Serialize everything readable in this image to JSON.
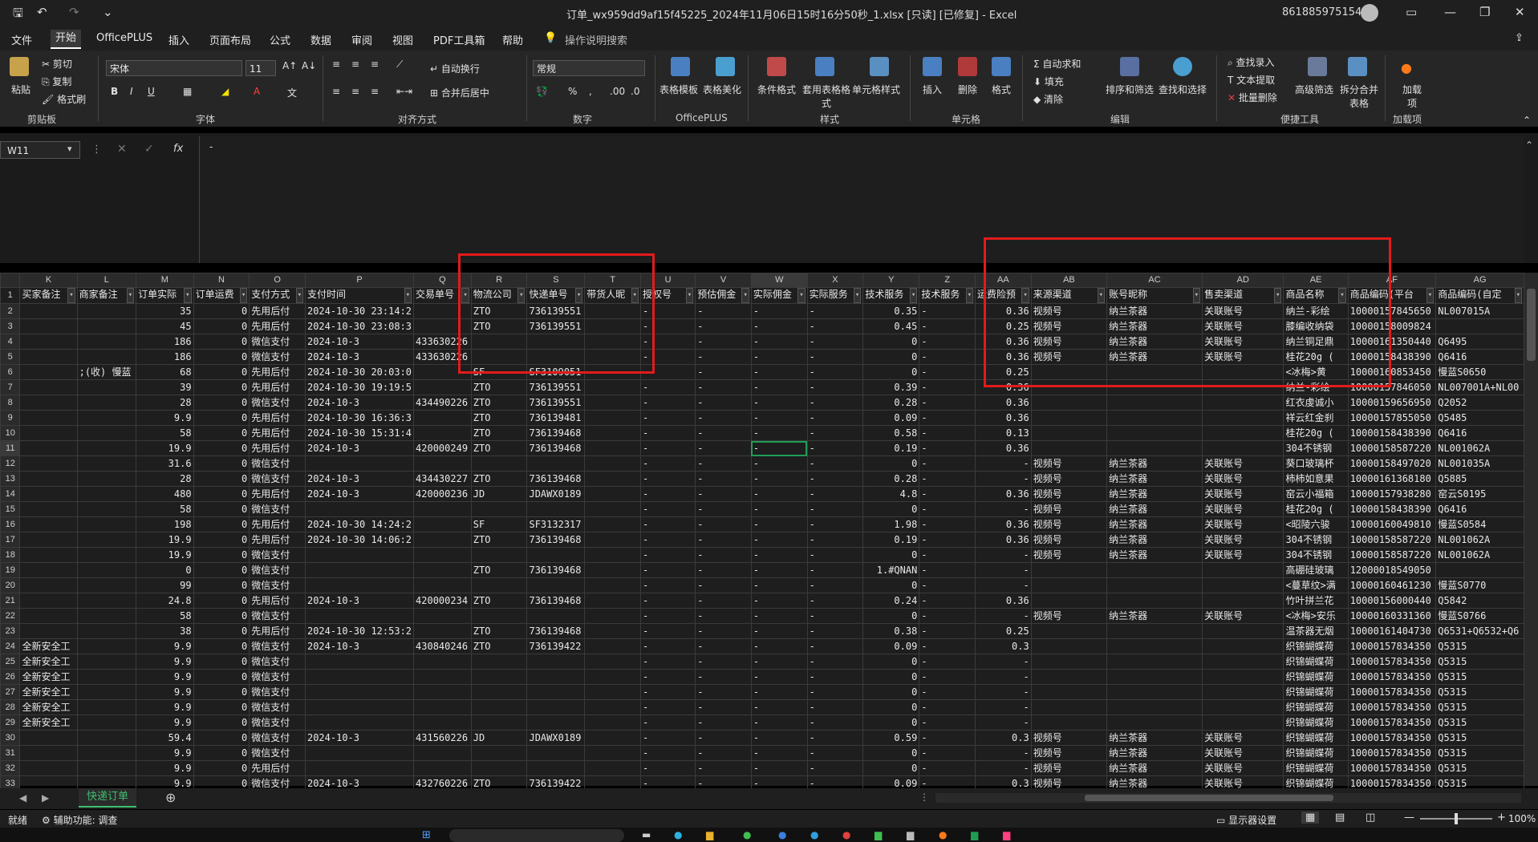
{
  "titlebar": {
    "title": "订单_wx959dd9af15f45225_2024年11月06日15时16分50秒_1.xlsx  [只读] [已修复]  -  Excel",
    "user": "8618859751545"
  },
  "menu": [
    "文件",
    "开始",
    "OfficePLUS",
    "插入",
    "页面布局",
    "公式",
    "数据",
    "审阅",
    "视图",
    "PDF工具箱",
    "帮助"
  ],
  "search_placeholder": "操作说明搜索",
  "ribbon": {
    "clipboard": {
      "paste": "粘贴",
      "cut": "剪切",
      "copy": "复制",
      "format_painter": "格式刷",
      "group": "剪贴板"
    },
    "font": {
      "name": "宋体",
      "size": "11",
      "group": "字体"
    },
    "alignment": {
      "wrap": "自动换行",
      "merge": "合并后居中",
      "group": "对齐方式"
    },
    "number": {
      "format": "常规",
      "group": "数字"
    },
    "officeplus": {
      "table_template": "表格模板",
      "table_beautify": "表格美化",
      "group": "OfficePLUS"
    },
    "styles": {
      "conditional": "条件格式",
      "apply": "套用表格格式",
      "cell_styles": "单元格样式",
      "group": "样式"
    },
    "cells": {
      "insert": "插入",
      "delete": "删除",
      "format": "格式",
      "group": "单元格"
    },
    "editing": {
      "autosum": "自动求和",
      "fill": "填充",
      "clear": "清除",
      "sort": "排序和筛选",
      "find": "查找和选择",
      "group": "编辑"
    },
    "tools": {
      "find_input": "查找录入",
      "text_extract": "文本提取",
      "batch_delete": "批量删除",
      "adv_filter": "高级筛选",
      "split_merge": "拆分合并表格",
      "group": "便捷工具"
    },
    "addins": {
      "label": "加载项",
      "group": "加载项"
    }
  },
  "formula": {
    "namebox": "W11",
    "value": "-"
  },
  "columns": [
    "K",
    "L",
    "M",
    "N",
    "O",
    "P",
    "Q",
    "R",
    "S",
    "T",
    "U",
    "V",
    "W",
    "X",
    "Y",
    "Z",
    "AA",
    "AB",
    "AC",
    "AD",
    "AE",
    "AF",
    "AG"
  ],
  "header_row": [
    "买家备注",
    "商家备注",
    "订单实际",
    "订单运费",
    "支付方式",
    "支付时间",
    "交易单号",
    "物流公司",
    "快递单号",
    "带货人昵",
    "授权号",
    "预估佣金",
    "实际佣金",
    "实际服务",
    "技术服务",
    "技术服务",
    "运费险预",
    "来源渠道",
    "账号昵称",
    "售卖渠道",
    "商品名称",
    "商品编码(平台",
    "商品编码(自定"
  ],
  "rows": [
    [
      "",
      "",
      "35",
      "0",
      "先用后付",
      "2024-10-30  23:14:2",
      "",
      "ZTO",
      "736139551",
      "",
      "-",
      "-",
      "-",
      "-",
      "0.35",
      "-",
      "0.36",
      "视频号",
      "纳兰茶器",
      "关联账号",
      "纳兰-彩绘",
      "10000157845650",
      "NL007015A"
    ],
    [
      "",
      "",
      "45",
      "0",
      "先用后付",
      "2024-10-30  23:08:3",
      "",
      "ZTO",
      "736139551",
      "",
      "-",
      "-",
      "-",
      "-",
      "0.45",
      "-",
      "0.25",
      "视频号",
      "纳兰茶器",
      "关联账号",
      "膝编收纳袋",
      "10000158009824",
      ""
    ],
    [
      "",
      "",
      "186",
      "0",
      "微信支付",
      "2024-10-3",
      "433630226",
      "",
      "",
      "",
      "-",
      "-",
      "-",
      "-",
      "0",
      "-",
      "0.36",
      "视频号",
      "纳兰茶器",
      "关联账号",
      "纳兰铜足鼎",
      "10000161350440",
      "Q6495"
    ],
    [
      "",
      "",
      "186",
      "0",
      "微信支付",
      "2024-10-3",
      "433630226",
      "",
      "",
      "",
      "-",
      "-",
      "-",
      "-",
      "0",
      "-",
      "0.36",
      "视频号",
      "纳兰茶器",
      "关联账号",
      "桂花20g (",
      "10000158438390",
      "Q6416"
    ],
    [
      "",
      ";(收) 慢蓝",
      "68",
      "0",
      "先用后付",
      "2024-10-30  20:03:0",
      "",
      "SF",
      "SF3109051",
      "",
      "-",
      "-",
      "-",
      "-",
      "0",
      "-",
      "0.25",
      "",
      "",
      "",
      "<冰梅>黄",
      "10000160853450",
      "慢蓝S0650"
    ],
    [
      "",
      "",
      "39",
      "0",
      "先用后付",
      "2024-10-30  19:19:5",
      "",
      "ZTO",
      "736139551",
      "",
      "-",
      "-",
      "-",
      "-",
      "0.39",
      "-",
      "0.36",
      "",
      "",
      "",
      "纳兰-彩绘",
      "10000157846050",
      "NL007001A+NL00"
    ],
    [
      "",
      "",
      "28",
      "0",
      "微信支付",
      "2024-10-3",
      "434490226",
      "ZTO",
      "736139551",
      "",
      "-",
      "-",
      "-",
      "-",
      "0.28",
      "-",
      "0.36",
      "",
      "",
      "",
      "红衣虔诚小",
      "10000159656950",
      "Q2052"
    ],
    [
      "",
      "",
      "9.9",
      "0",
      "先用后付",
      "2024-10-30  16:36:3",
      "",
      "ZTO",
      "736139481",
      "",
      "-",
      "-",
      "-",
      "-",
      "0.09",
      "-",
      "0.36",
      "",
      "",
      "",
      "祥云红金刹",
      "10000157855050",
      "Q5485"
    ],
    [
      "",
      "",
      "58",
      "0",
      "先用后付",
      "2024-10-30  15:31:4",
      "",
      "ZTO",
      "736139468",
      "",
      "-",
      "-",
      "-",
      "-",
      "0.58",
      "-",
      "0.13",
      "",
      "",
      "",
      "桂花20g (",
      "10000158438390",
      "Q6416"
    ],
    [
      "",
      "",
      "19.9",
      "0",
      "先用后付",
      "2024-10-3",
      "420000249",
      "ZTO",
      "736139468",
      "",
      "-",
      "-",
      "-",
      "-",
      "0.19",
      "-",
      "0.36",
      "",
      "",
      "",
      "304不锈钢",
      "10000158587220",
      "NL001062A"
    ],
    [
      "",
      "",
      "31.6",
      "0",
      "微信支付",
      "",
      "",
      "",
      "",
      "",
      "-",
      "-",
      "-",
      "-",
      "0",
      "-",
      "-",
      "视频号",
      "纳兰茶器",
      "关联账号",
      "葵口玻璃杯",
      "10000158497020",
      "NL001035A"
    ],
    [
      "",
      "",
      "28",
      "0",
      "微信支付",
      "2024-10-3",
      "434430227",
      "ZTO",
      "736139468",
      "",
      "-",
      "-",
      "-",
      "-",
      "0.28",
      "-",
      "-",
      "视频号",
      "纳兰茶器",
      "关联账号",
      "柿柿如意果",
      "10000161368180",
      "Q5885"
    ],
    [
      "",
      "",
      "480",
      "0",
      "先用后付",
      "2024-10-3",
      "420000236",
      "JD",
      "JDAWX0189",
      "",
      "-",
      "-",
      "-",
      "-",
      "4.8",
      "-",
      "0.36",
      "视频号",
      "纳兰茶器",
      "关联账号",
      "窑云小福箱",
      "10000157938280",
      "窑云S0195"
    ],
    [
      "",
      "",
      "58",
      "0",
      "微信支付",
      "",
      "",
      "",
      "",
      "",
      "-",
      "-",
      "-",
      "-",
      "0",
      "-",
      "-",
      "视频号",
      "纳兰茶器",
      "关联账号",
      "桂花20g (",
      "10000158438390",
      "Q6416"
    ],
    [
      "",
      "",
      "198",
      "0",
      "先用后付",
      "2024-10-30  14:24:2",
      "",
      "SF",
      "SF3132317",
      "",
      "-",
      "-",
      "-",
      "-",
      "1.98",
      "-",
      "0.36",
      "视频号",
      "纳兰茶器",
      "关联账号",
      "<昭陵六骏",
      "10000160049810",
      "慢蓝S0584"
    ],
    [
      "",
      "",
      "19.9",
      "0",
      "先用后付",
      "2024-10-30  14:06:2",
      "",
      "ZTO",
      "736139468",
      "",
      "-",
      "-",
      "-",
      "-",
      "0.19",
      "-",
      "0.36",
      "视频号",
      "纳兰茶器",
      "关联账号",
      "304不锈钢",
      "10000158587220",
      "NL001062A"
    ],
    [
      "",
      "",
      "19.9",
      "0",
      "微信支付",
      "",
      "",
      "",
      "",
      "",
      "-",
      "-",
      "-",
      "-",
      "0",
      "-",
      "-",
      "视频号",
      "纳兰茶器",
      "关联账号",
      "304不锈钢",
      "10000158587220",
      "NL001062A"
    ],
    [
      "",
      "",
      "0",
      "0",
      "微信支付",
      "",
      "",
      "ZTO",
      "736139468",
      "",
      "-",
      "-",
      "-",
      "-",
      "1.#QNAN",
      "-",
      "-",
      "",
      "",
      "",
      "高硼硅玻璃",
      "12000018549050",
      ""
    ],
    [
      "",
      "",
      "99",
      "0",
      "微信支付",
      "",
      "",
      "",
      "",
      "",
      "-",
      "-",
      "-",
      "-",
      "0",
      "-",
      "-",
      "",
      "",
      "",
      "<蔓草纹>满",
      "10000160461230",
      "慢蓝S0770"
    ],
    [
      "",
      "",
      "24.8",
      "0",
      "先用后付",
      "2024-10-3",
      "420000234",
      "ZTO",
      "736139468",
      "",
      "-",
      "-",
      "-",
      "-",
      "0.24",
      "-",
      "0.36",
      "",
      "",
      "",
      "竹叶拼兰花",
      "10000156000440",
      "Q5842"
    ],
    [
      "",
      "",
      "58",
      "0",
      "微信支付",
      "",
      "",
      "",
      "",
      "",
      "-",
      "-",
      "-",
      "-",
      "0",
      "-",
      "-",
      "视频号",
      "纳兰茶器",
      "关联账号",
      "<冰梅>安乐",
      "10000160331360",
      "慢蓝S0766"
    ],
    [
      "",
      "",
      "38",
      "0",
      "先用后付",
      "2024-10-30  12:53:2",
      "",
      "ZTO",
      "736139468",
      "",
      "-",
      "-",
      "-",
      "-",
      "0.38",
      "-",
      "0.25",
      "",
      "",
      "",
      "温茶器无烟",
      "10000161404730",
      "Q6531+Q6532+Q6"
    ],
    [
      "全新安全工",
      "",
      "9.9",
      "0",
      "微信支付",
      "2024-10-3",
      "430840246",
      "ZTO",
      "736139422",
      "",
      "-",
      "-",
      "-",
      "-",
      "0.09",
      "-",
      "0.3",
      "",
      "",
      "",
      "织锦蝴蝶荷",
      "10000157834350",
      "Q5315"
    ],
    [
      "全新安全工",
      "",
      "9.9",
      "0",
      "微信支付",
      "",
      "",
      "",
      "",
      "",
      "-",
      "-",
      "-",
      "-",
      "0",
      "-",
      "-",
      "",
      "",
      "",
      "织锦蝴蝶荷",
      "10000157834350",
      "Q5315"
    ],
    [
      "全新安全工",
      "",
      "9.9",
      "0",
      "微信支付",
      "",
      "",
      "",
      "",
      "",
      "-",
      "-",
      "-",
      "-",
      "0",
      "-",
      "-",
      "",
      "",
      "",
      "织锦蝴蝶荷",
      "10000157834350",
      "Q5315"
    ],
    [
      "全新安全工",
      "",
      "9.9",
      "0",
      "微信支付",
      "",
      "",
      "",
      "",
      "",
      "-",
      "-",
      "-",
      "-",
      "0",
      "-",
      "-",
      "",
      "",
      "",
      "织锦蝴蝶荷",
      "10000157834350",
      "Q5315"
    ],
    [
      "全新安全工",
      "",
      "9.9",
      "0",
      "微信支付",
      "",
      "",
      "",
      "",
      "",
      "-",
      "-",
      "-",
      "-",
      "0",
      "-",
      "-",
      "",
      "",
      "",
      "织锦蝴蝶荷",
      "10000157834350",
      "Q5315"
    ],
    [
      "全新安全工",
      "",
      "9.9",
      "0",
      "微信支付",
      "",
      "",
      "",
      "",
      "",
      "-",
      "-",
      "-",
      "-",
      "0",
      "-",
      "-",
      "",
      "",
      "",
      "织锦蝴蝶荷",
      "10000157834350",
      "Q5315"
    ],
    [
      "",
      "",
      "59.4",
      "0",
      "微信支付",
      "2024-10-3",
      "431560226",
      "JD",
      "JDAWX0189",
      "",
      "-",
      "-",
      "-",
      "-",
      "0.59",
      "-",
      "0.3",
      "视频号",
      "纳兰茶器",
      "关联账号",
      "织锦蝴蝶荷",
      "10000157834350",
      "Q5315"
    ],
    [
      "",
      "",
      "9.9",
      "0",
      "微信支付",
      "",
      "",
      "",
      "",
      "",
      "-",
      "-",
      "-",
      "-",
      "0",
      "-",
      "-",
      "视频号",
      "纳兰茶器",
      "关联账号",
      "织锦蝴蝶荷",
      "10000157834350",
      "Q5315"
    ],
    [
      "",
      "",
      "9.9",
      "0",
      "先用后付",
      "",
      "",
      "",
      "",
      "",
      "-",
      "-",
      "-",
      "-",
      "0",
      "-",
      "-",
      "视频号",
      "纳兰茶器",
      "关联账号",
      "织锦蝴蝶荷",
      "10000157834350",
      "Q5315"
    ],
    [
      "",
      "",
      "9.9",
      "0",
      "微信支付",
      "2024-10-3",
      "432760226",
      "ZTO",
      "736139422",
      "",
      "-",
      "-",
      "-",
      "-",
      "0.09",
      "-",
      "0.3",
      "视频号",
      "纳兰茶器",
      "关联账号",
      "织锦蝴蝶荷",
      "10000157834350",
      "Q5315"
    ]
  ],
  "sheet_tab": "快递订单",
  "status": {
    "ready": "就绪",
    "accessibility": "辅助功能: 调查",
    "display_settings": "显示器设置",
    "zoom": "100%"
  }
}
